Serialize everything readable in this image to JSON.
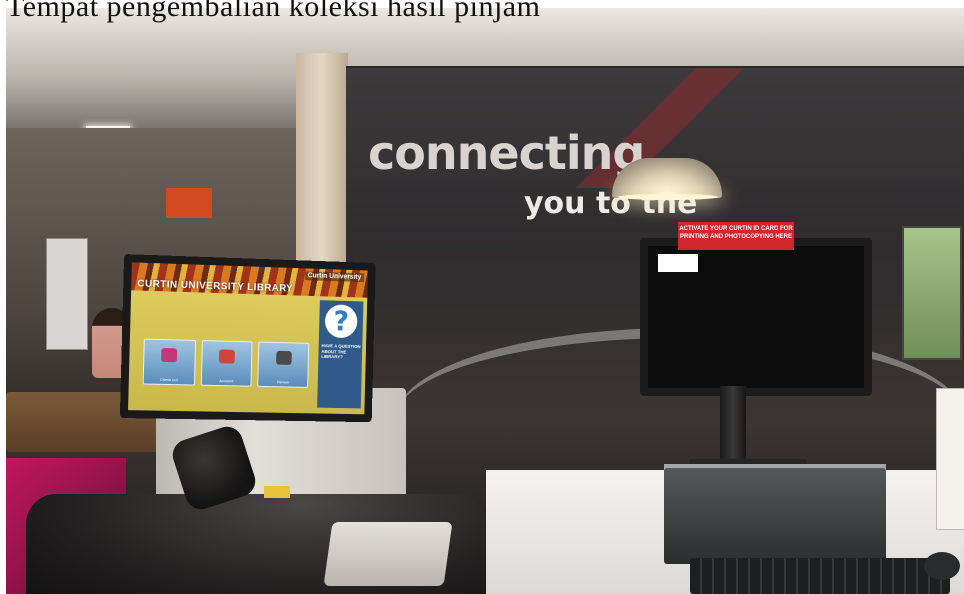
{
  "caption": "Tempat pengembalian koleksi hasil pinjam",
  "wall_graphic": {
    "line1": "connecting",
    "line2": "you to the"
  },
  "kiosk": {
    "brand": "Curtin University",
    "title": "CURTIN UNIVERSITY LIBRARY",
    "tiles": [
      {
        "label": "Check out",
        "icon": "basket-icon",
        "color": "#c03a7a"
      },
      {
        "label": "Account",
        "icon": "card-icon",
        "color": "#d2433a"
      },
      {
        "label": "Renew",
        "icon": "books-icon",
        "color": "#4a4a4a"
      }
    ],
    "help_mark": "?",
    "help_text": "HAVE A QUESTION ABOUT THE LIBRARY?"
  },
  "monitor_sign": "ACTIVATE YOUR CURTIN ID CARD FOR PRINTING AND PHOTOCOPYING HERE",
  "colors": {
    "sign_red": "#d1262c",
    "kiosk_yellow": "#d9c85a",
    "help_blue": "#2f5a8a",
    "floor_pink": "#c0185c"
  }
}
